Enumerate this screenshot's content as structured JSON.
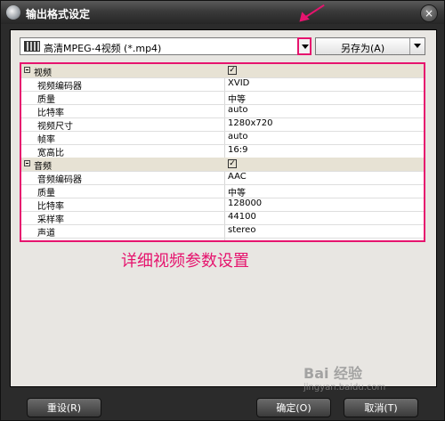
{
  "window": {
    "title": "输出格式设定"
  },
  "format": {
    "selected": "高清MPEG-4视频 (*.mp4)",
    "save_as": "另存为(A)"
  },
  "grid": [
    {
      "type": "category",
      "name": "视频",
      "checked": "✓"
    },
    {
      "type": "item",
      "name": "视频编码器",
      "value": "XVID"
    },
    {
      "type": "item",
      "name": "质量",
      "value": "中等"
    },
    {
      "type": "item",
      "name": "比特率",
      "value": "auto"
    },
    {
      "type": "item",
      "name": "视频尺寸",
      "value": "1280x720"
    },
    {
      "type": "item",
      "name": "帧率",
      "value": "auto"
    },
    {
      "type": "item",
      "name": "宽高比",
      "value": "16:9"
    },
    {
      "type": "category",
      "name": "音频",
      "checked": "✓"
    },
    {
      "type": "item",
      "name": "音频编码器",
      "value": "AAC"
    },
    {
      "type": "item",
      "name": "质量",
      "value": "中等"
    },
    {
      "type": "item",
      "name": "比特率",
      "value": "128000"
    },
    {
      "type": "item",
      "name": "采样率",
      "value": "44100"
    },
    {
      "type": "item",
      "name": "声道",
      "value": "stereo"
    }
  ],
  "annotation": "详细视频参数设置",
  "buttons": {
    "reset": "重设(R)",
    "ok": "确定(O)",
    "cancel": "取消(T)"
  },
  "watermark": {
    "logo": "Bai 经验",
    "url": "jingyan.baidu.com"
  }
}
